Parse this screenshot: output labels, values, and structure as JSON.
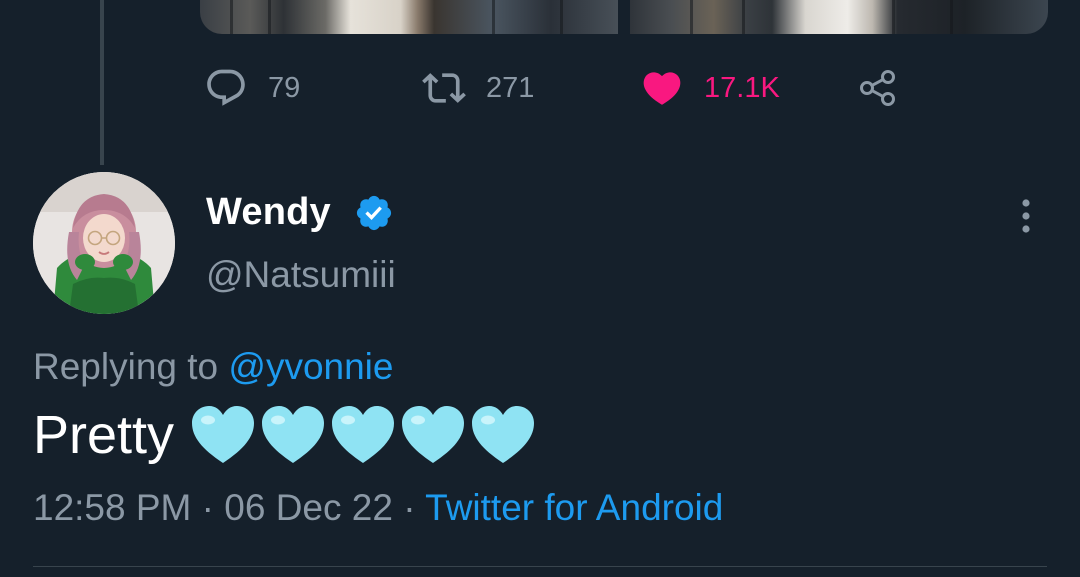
{
  "previous_tweet": {
    "media": {
      "left_image": "photo",
      "right_image": "photo"
    },
    "actions": {
      "reply": {
        "icon": "reply-icon",
        "count": "79"
      },
      "retweet": {
        "icon": "retweet-icon",
        "count": "271"
      },
      "like": {
        "icon": "heart-filled-icon",
        "count": "17.1K",
        "liked": true,
        "color": "#f91880"
      },
      "share": {
        "icon": "share-icon"
      }
    }
  },
  "reply_tweet": {
    "author": {
      "display_name": "Wendy",
      "verified": true,
      "handle": "@Natsumiii"
    },
    "more_icon": "more-vertical-icon",
    "replying_label": "Replying to ",
    "replying_to": "@yvonnie",
    "text": "Pretty",
    "emoji": [
      "light-blue-heart",
      "light-blue-heart",
      "light-blue-heart",
      "light-blue-heart",
      "light-blue-heart"
    ],
    "time": "12:58 PM",
    "separator": " · ",
    "date": "06 Dec 22",
    "source": "Twitter for Android"
  },
  "colors": {
    "background": "#15202b",
    "secondary_text": "#8b98a5",
    "accent": "#1d9bf0",
    "like": "#f91880",
    "divider": "#38444d",
    "emoji_heart": "#8fe3f3"
  }
}
